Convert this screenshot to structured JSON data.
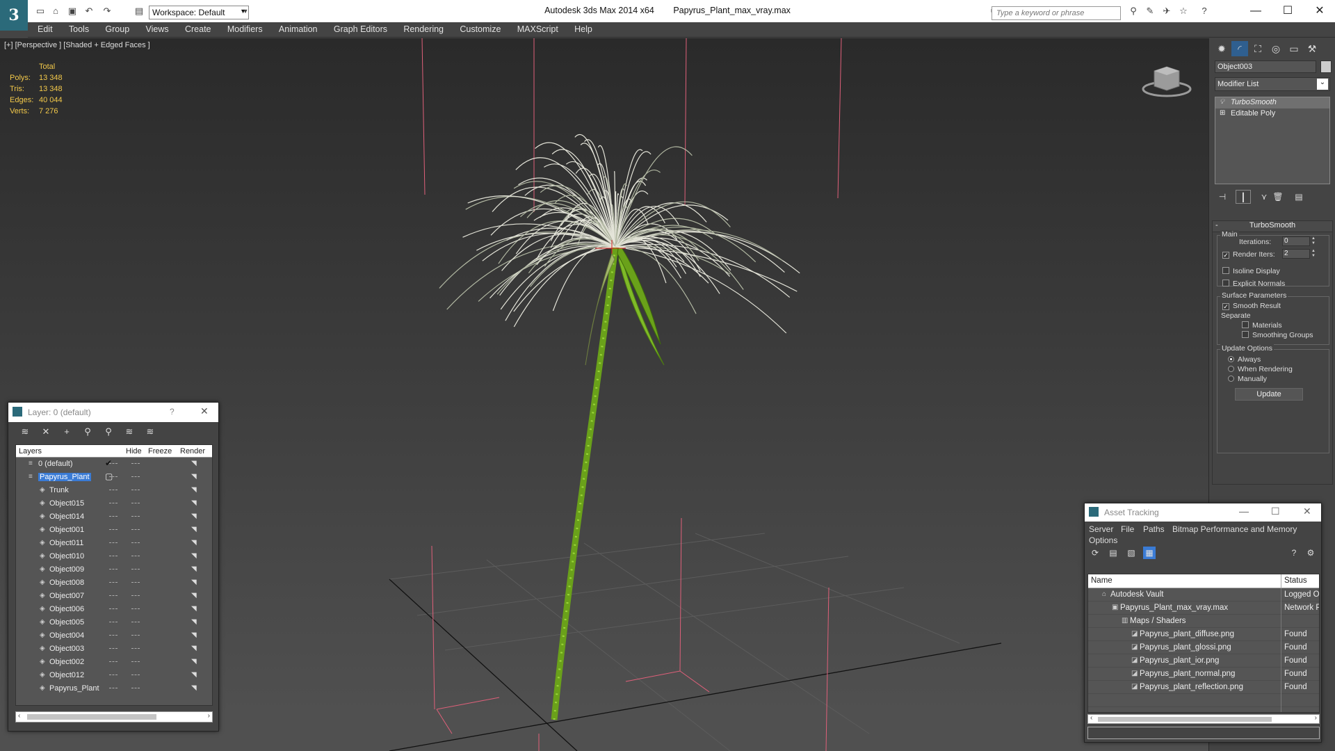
{
  "titlebar": {
    "app_title": "Autodesk 3ds Max  2014 x64",
    "file_name": "Papyrus_Plant_max_vray.max",
    "workspace_label": "Workspace: Default",
    "search_placeholder": "Type a keyword or phrase"
  },
  "menu": [
    "Edit",
    "Tools",
    "Group",
    "Views",
    "Create",
    "Modifiers",
    "Animation",
    "Graph Editors",
    "Rendering",
    "Customize",
    "MAXScript",
    "Help"
  ],
  "viewport": {
    "label": "[+] [Perspective ] [Shaded + Edged Faces ]",
    "stats": {
      "header": "Total",
      "polys_label": "Polys:",
      "polys": "13 348",
      "tris_label": "Tris:",
      "tris": "13 348",
      "edges_label": "Edges:",
      "edges": "40 044",
      "verts_label": "Verts:",
      "verts": "7 276"
    }
  },
  "command_panel": {
    "object_name": "Object003",
    "modifier_list": "Modifier List",
    "stack": [
      {
        "label": "TurboSmooth",
        "selected": true
      },
      {
        "label": "Editable Poly",
        "selected": false
      }
    ],
    "rollout": {
      "title": "TurboSmooth",
      "main_group": "Main",
      "iterations_label": "Iterations:",
      "iterations_value": "0",
      "render_iters_label": "Render Iters:",
      "render_iters_value": "2",
      "isoline_label": "Isoline Display",
      "explicit_normals_label": "Explicit Normals",
      "surface_group": "Surface Parameters",
      "smooth_result_label": "Smooth Result",
      "separate_label": "Separate",
      "materials_label": "Materials",
      "smoothing_groups_label": "Smoothing Groups",
      "update_group": "Update Options",
      "always_label": "Always",
      "when_rendering_label": "When Rendering",
      "manually_label": "Manually",
      "update_button": "Update"
    }
  },
  "layer_window": {
    "title": "Layer: 0 (default)",
    "help": "?",
    "columns": {
      "layers": "Layers",
      "hide": "Hide",
      "freeze": "Freeze",
      "render": "Render"
    },
    "rows": [
      {
        "name": "0 (default)",
        "level": 0,
        "active": true,
        "selected": false
      },
      {
        "name": "Papyrus_Plant",
        "level": 0,
        "active": false,
        "selected": true
      },
      {
        "name": "Trunk",
        "level": 1
      },
      {
        "name": "Object015",
        "level": 1
      },
      {
        "name": "Object014",
        "level": 1
      },
      {
        "name": "Object001",
        "level": 1
      },
      {
        "name": "Object011",
        "level": 1
      },
      {
        "name": "Object010",
        "level": 1
      },
      {
        "name": "Object009",
        "level": 1
      },
      {
        "name": "Object008",
        "level": 1
      },
      {
        "name": "Object007",
        "level": 1
      },
      {
        "name": "Object006",
        "level": 1
      },
      {
        "name": "Object005",
        "level": 1
      },
      {
        "name": "Object004",
        "level": 1
      },
      {
        "name": "Object003",
        "level": 1
      },
      {
        "name": "Object002",
        "level": 1
      },
      {
        "name": "Object012",
        "level": 1
      },
      {
        "name": "Papyrus_Plant",
        "level": 1
      }
    ]
  },
  "asset_window": {
    "title": "Asset Tracking",
    "menu": [
      "Server",
      "File",
      "Paths",
      "Bitmap Performance and Memory",
      "Options"
    ],
    "columns": {
      "name": "Name",
      "status": "Status"
    },
    "rows": [
      {
        "name": "Autodesk Vault",
        "level": 0,
        "status": "Logged Out"
      },
      {
        "name": "Papyrus_Plant_max_vray.max",
        "level": 1,
        "status": "Network Path"
      },
      {
        "name": "Maps / Shaders",
        "level": 2,
        "status": ""
      },
      {
        "name": "Papyrus_plant_diffuse.png",
        "level": 3,
        "status": "Found"
      },
      {
        "name": "Papyrus_plant_glossi.png",
        "level": 3,
        "status": "Found"
      },
      {
        "name": "Papyrus_plant_ior.png",
        "level": 3,
        "status": "Found"
      },
      {
        "name": "Papyrus_plant_normal.png",
        "level": 3,
        "status": "Found"
      },
      {
        "name": "Papyrus_plant_reflection.png",
        "level": 3,
        "status": "Found"
      }
    ]
  },
  "colors": {
    "stats": "#f3c94a",
    "selection": "#3a7bd5",
    "stem": "#7cb518",
    "fronds": "#e8e8dc",
    "helper_lines": "#e0607a"
  }
}
